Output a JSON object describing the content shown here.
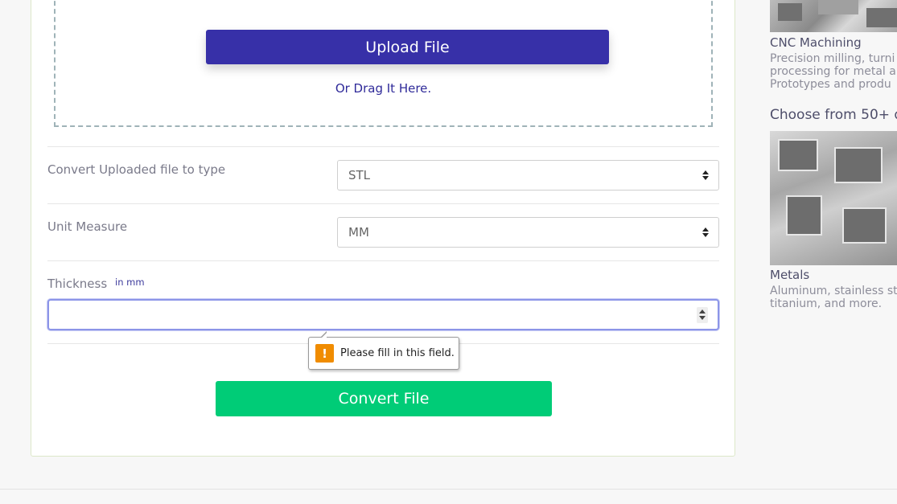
{
  "upload": {
    "button_label": "Upload File",
    "drag_text": "Or Drag It Here."
  },
  "form": {
    "convert_type": {
      "label": "Convert Uploaded file to type",
      "value": "STL"
    },
    "unit_measure": {
      "label": "Unit Measure",
      "value": "MM"
    },
    "thickness": {
      "label": "Thickness",
      "hint": "in mm",
      "value": ""
    },
    "validation_message": "Please fill in this field.",
    "convert_button_label": "Convert File"
  },
  "sidebar": {
    "cnc": {
      "title": "CNC Machining",
      "description_lines": [
        "Precision milling, turni",
        "processing for metal a",
        "Prototypes and produ"
      ]
    },
    "heading": "Choose from 50+ q",
    "metals": {
      "title": "Metals",
      "description_lines": [
        "Aluminum, stainless st",
        "titanium, and more."
      ]
    }
  },
  "colors": {
    "upload_button": "#3730a8",
    "convert_button": "#00cc77",
    "warning": "#f08c00"
  },
  "icons": {
    "warning": "warning-icon",
    "select_caret": "chevron-up-down-icon",
    "number_spinner": "spinner-icon"
  }
}
